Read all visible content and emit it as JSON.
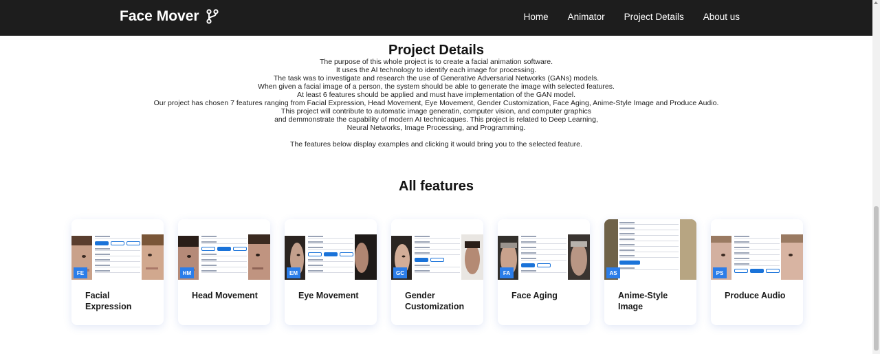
{
  "navbar": {
    "brand": "Face Mover",
    "brand_icon": "git-fork-icon",
    "links": [
      "Home",
      "Animator",
      "Project Details",
      "About us"
    ]
  },
  "details": {
    "title": "Project Details",
    "lines": [
      "The purpose of this whole project is to create a facial animation software.",
      "It uses the AI technology to identify each image for processing.",
      "The task was to investigate and research the use of Generative Adversarial Networks (GANs) models.",
      "When given a facial image of a person, the system should be able to generate the image with selected features.",
      "At least 6 features should be applied and must have implementation of the GAN model.",
      "Our project has chosen 7 features ranging from Facial Expression, Head Movement, Eye Movement, Gender Customization, Face Aging, Anime-Style Image and Produce Audio.",
      "This project will contribute to automatic image generatin, computer vision, and computer graphics",
      "and demmonstrate the capability of modern AI technicaques. This project is related to Deep Learning,",
      "Neural Networks, Image Processing, and Programming."
    ],
    "note": "The features below display examples and clicking it would bring you to the selected feature."
  },
  "features": {
    "title": "All features",
    "cards": [
      {
        "abbr": "FE",
        "label": "Facial Expression"
      },
      {
        "abbr": "HM",
        "label": "Head Movement"
      },
      {
        "abbr": "EM",
        "label": "Eye Movement"
      },
      {
        "abbr": "GC",
        "label": "Gender Customization"
      },
      {
        "abbr": "FA",
        "label": "Face Aging"
      },
      {
        "abbr": "AS",
        "label": "Anime-Style Image"
      },
      {
        "abbr": "PS",
        "label": "Produce Audio"
      }
    ]
  },
  "colors": {
    "navbar_bg": "#1d1d1d",
    "accent": "#2b7de9"
  }
}
